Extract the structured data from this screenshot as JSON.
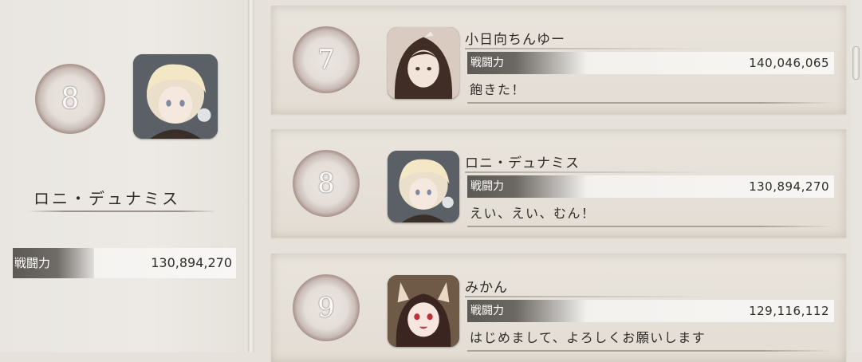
{
  "selected": {
    "rank": "8",
    "name": "ロニ・デュナミス",
    "power_label": "戦闘力",
    "power_value": "130,894,270"
  },
  "ranking": [
    {
      "rank": "7",
      "name": "小日向ちんゆー",
      "power_label": "戦闘力",
      "power_value": "140,046,065",
      "comment": "飽きた！",
      "avatar": "dark-haired-girl-avatar"
    },
    {
      "rank": "8",
      "name": "ロニ・デュナミス",
      "power_label": "戦闘力",
      "power_value": "130,894,270",
      "comment": "えい、えい、むん！",
      "avatar": "blonde-boy-avatar"
    },
    {
      "rank": "9",
      "name": "みかん",
      "power_label": "戦闘力",
      "power_value": "129,116,112",
      "comment": "はじめまして、よろしくお願いします",
      "avatar": "fox-eared-girl-avatar"
    }
  ]
}
